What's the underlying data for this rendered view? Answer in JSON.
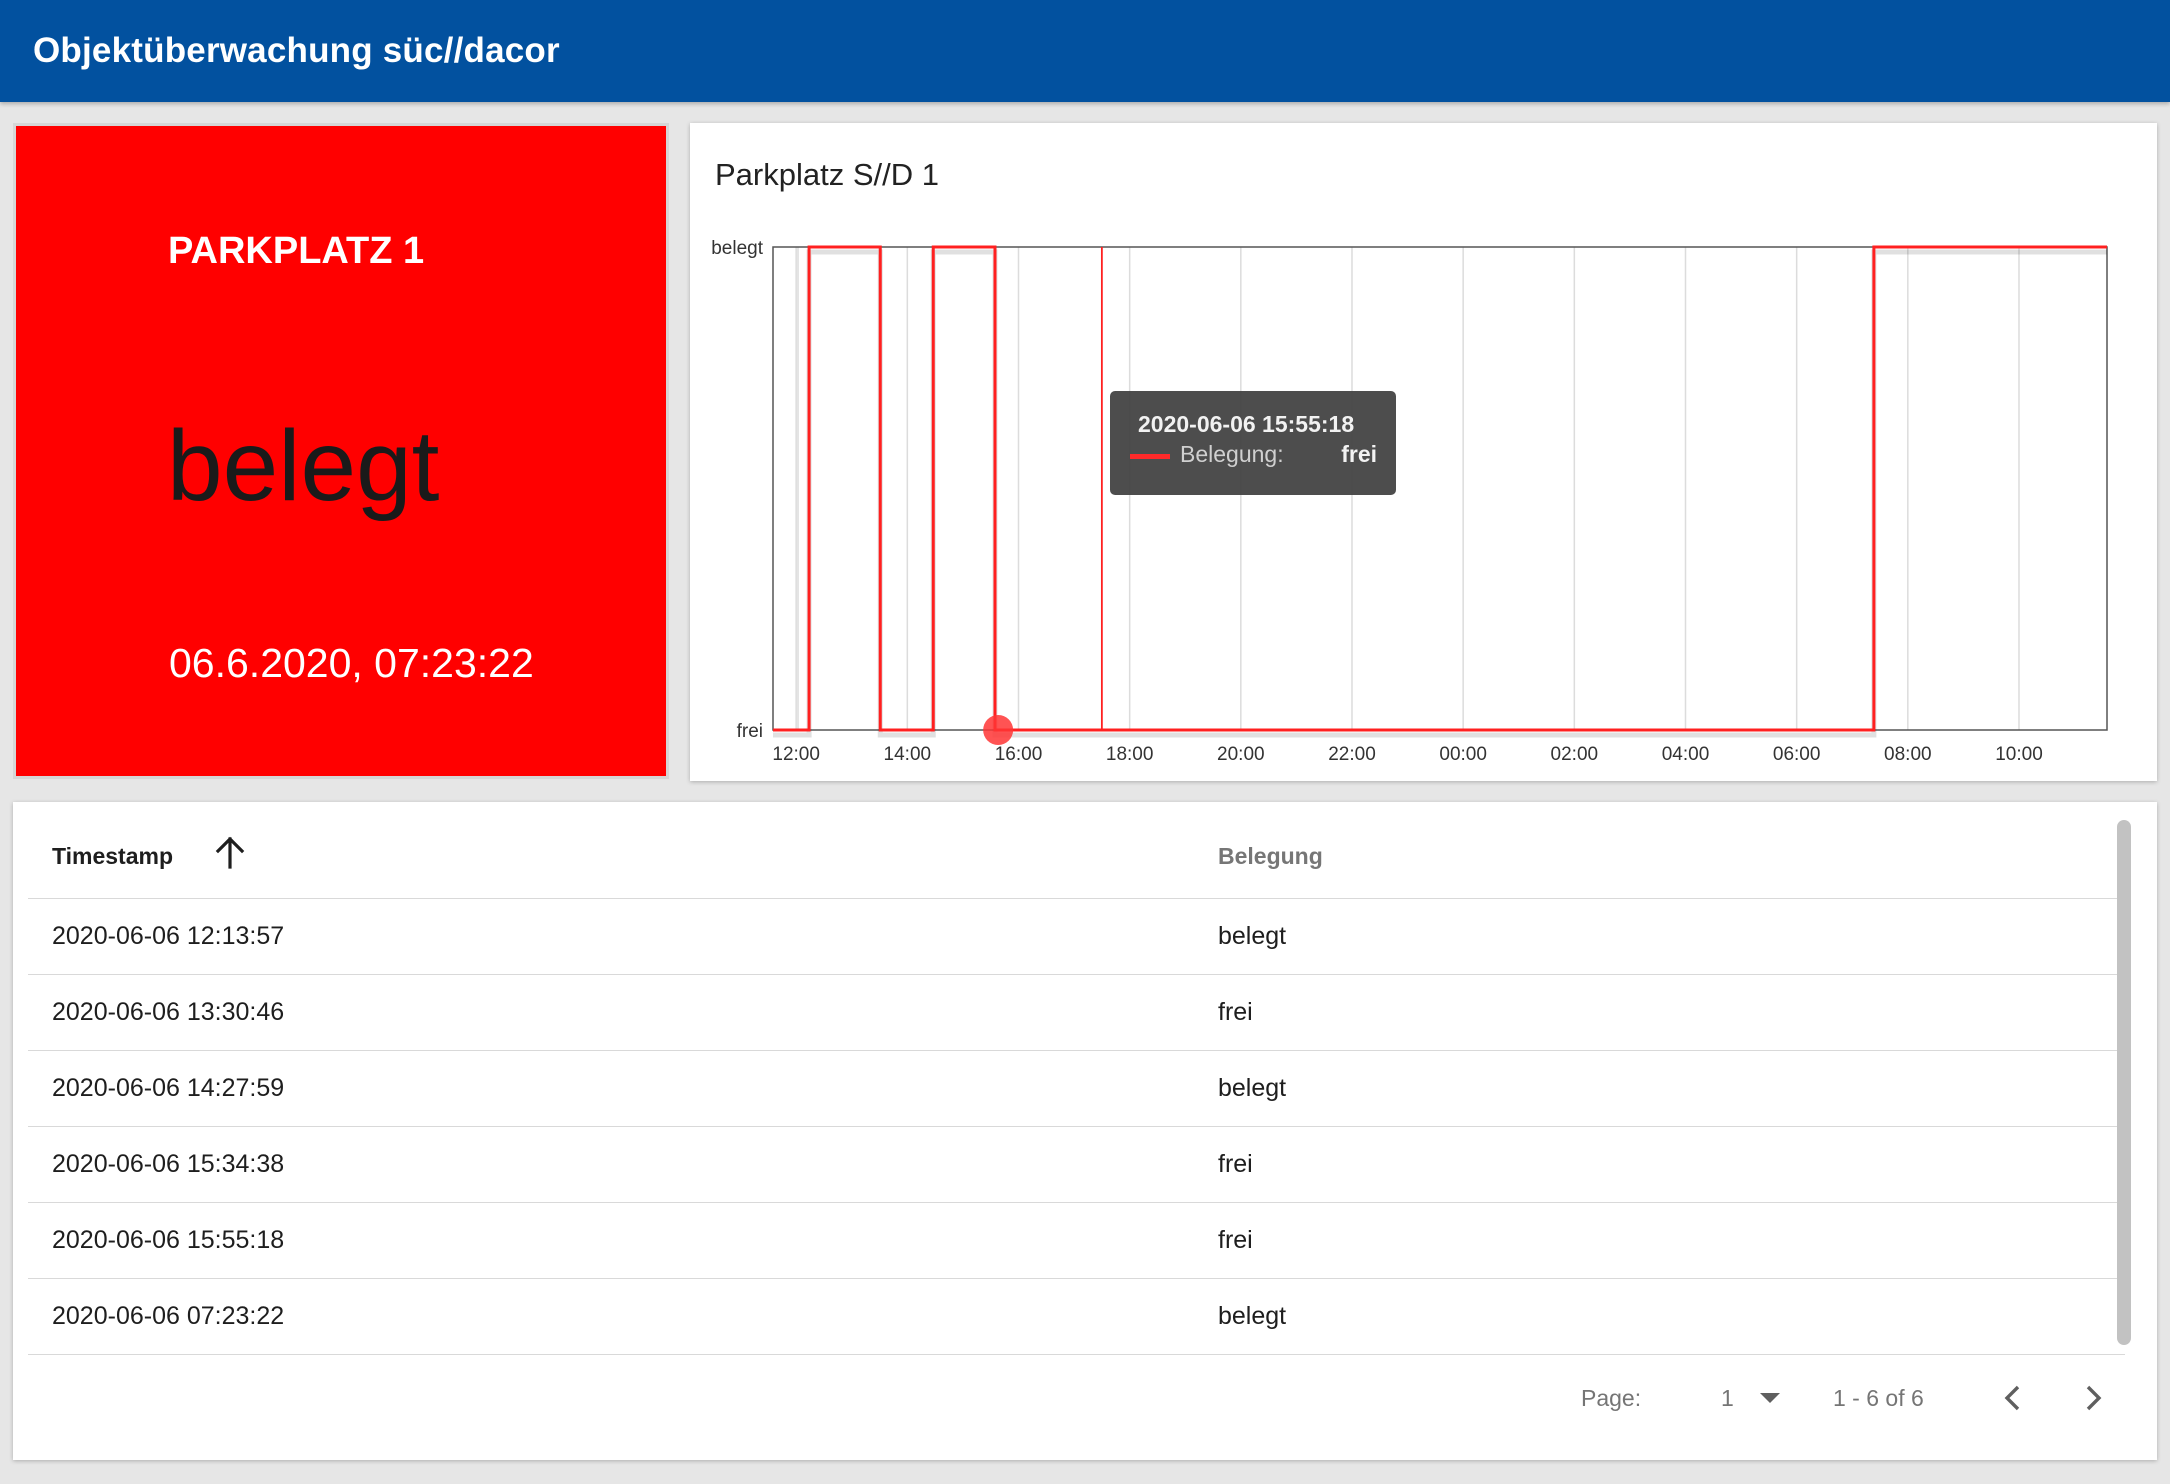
{
  "app": {
    "title": "Objektüberwachung süc//dacor"
  },
  "status": {
    "name": "PARKPLATZ 1",
    "value": "belegt",
    "timestamp": "06.6.2020, 07:23:22",
    "background_color": "#ff0000"
  },
  "chart": {
    "title": "Parkplatz S//D 1",
    "tooltip": {
      "date": "2020-06-06 15:55:18",
      "series_label": "Belegung:",
      "value": "frei"
    }
  },
  "chart_data": {
    "type": "line",
    "step": true,
    "title": "Parkplatz S//D 1",
    "xlabel": "",
    "ylabel": "",
    "y_categories": [
      "frei",
      "belegt"
    ],
    "x_ticks": [
      "12:00",
      "14:00",
      "16:00",
      "18:00",
      "20:00",
      "22:00",
      "00:00",
      "02:00",
      "04:00",
      "06:00",
      "08:00",
      "10:00"
    ],
    "x_range": [
      "2020-06-06 11:35",
      "2020-06-07 11:35"
    ],
    "grid": true,
    "series": [
      {
        "name": "Belegung",
        "color": "#ff2020",
        "points": [
          {
            "x": "2020-06-06 11:35",
            "y": "frei"
          },
          {
            "x": "2020-06-06 12:13:57",
            "y": "belegt"
          },
          {
            "x": "2020-06-06 13:30:46",
            "y": "frei"
          },
          {
            "x": "2020-06-06 14:27:59",
            "y": "belegt"
          },
          {
            "x": "2020-06-06 15:34:38",
            "y": "frei"
          },
          {
            "x": "2020-06-06 15:55:18",
            "y": "frei"
          },
          {
            "x": "2020-06-07 07:23:22",
            "y": "belegt"
          },
          {
            "x": "2020-06-07 11:35",
            "y": "belegt"
          }
        ]
      }
    ],
    "highlight": {
      "x": "2020-06-06 15:55:18",
      "y": "frei"
    },
    "marker_line": {
      "x": "2020-06-06 17:30"
    }
  },
  "table": {
    "columns": [
      "Timestamp",
      "Belegung"
    ],
    "sort_icon": "arrow-up-icon",
    "rows": [
      {
        "timestamp": "2020-06-06 12:13:57",
        "belegung": "belegt"
      },
      {
        "timestamp": "2020-06-06 13:30:46",
        "belegung": "frei"
      },
      {
        "timestamp": "2020-06-06 14:27:59",
        "belegung": "belegt"
      },
      {
        "timestamp": "2020-06-06 15:34:38",
        "belegung": "frei"
      },
      {
        "timestamp": "2020-06-06 15:55:18",
        "belegung": "frei"
      },
      {
        "timestamp": "2020-06-06 07:23:22",
        "belegung": "belegt"
      }
    ],
    "pagination": {
      "page_label": "Page:",
      "page": "1",
      "range": "1 - 6 of 6",
      "prev_icon": "chevron-left-icon",
      "next_icon": "chevron-right-icon"
    }
  },
  "colors": {
    "appbar": "#02519f",
    "accent_red": "#ff0000"
  }
}
